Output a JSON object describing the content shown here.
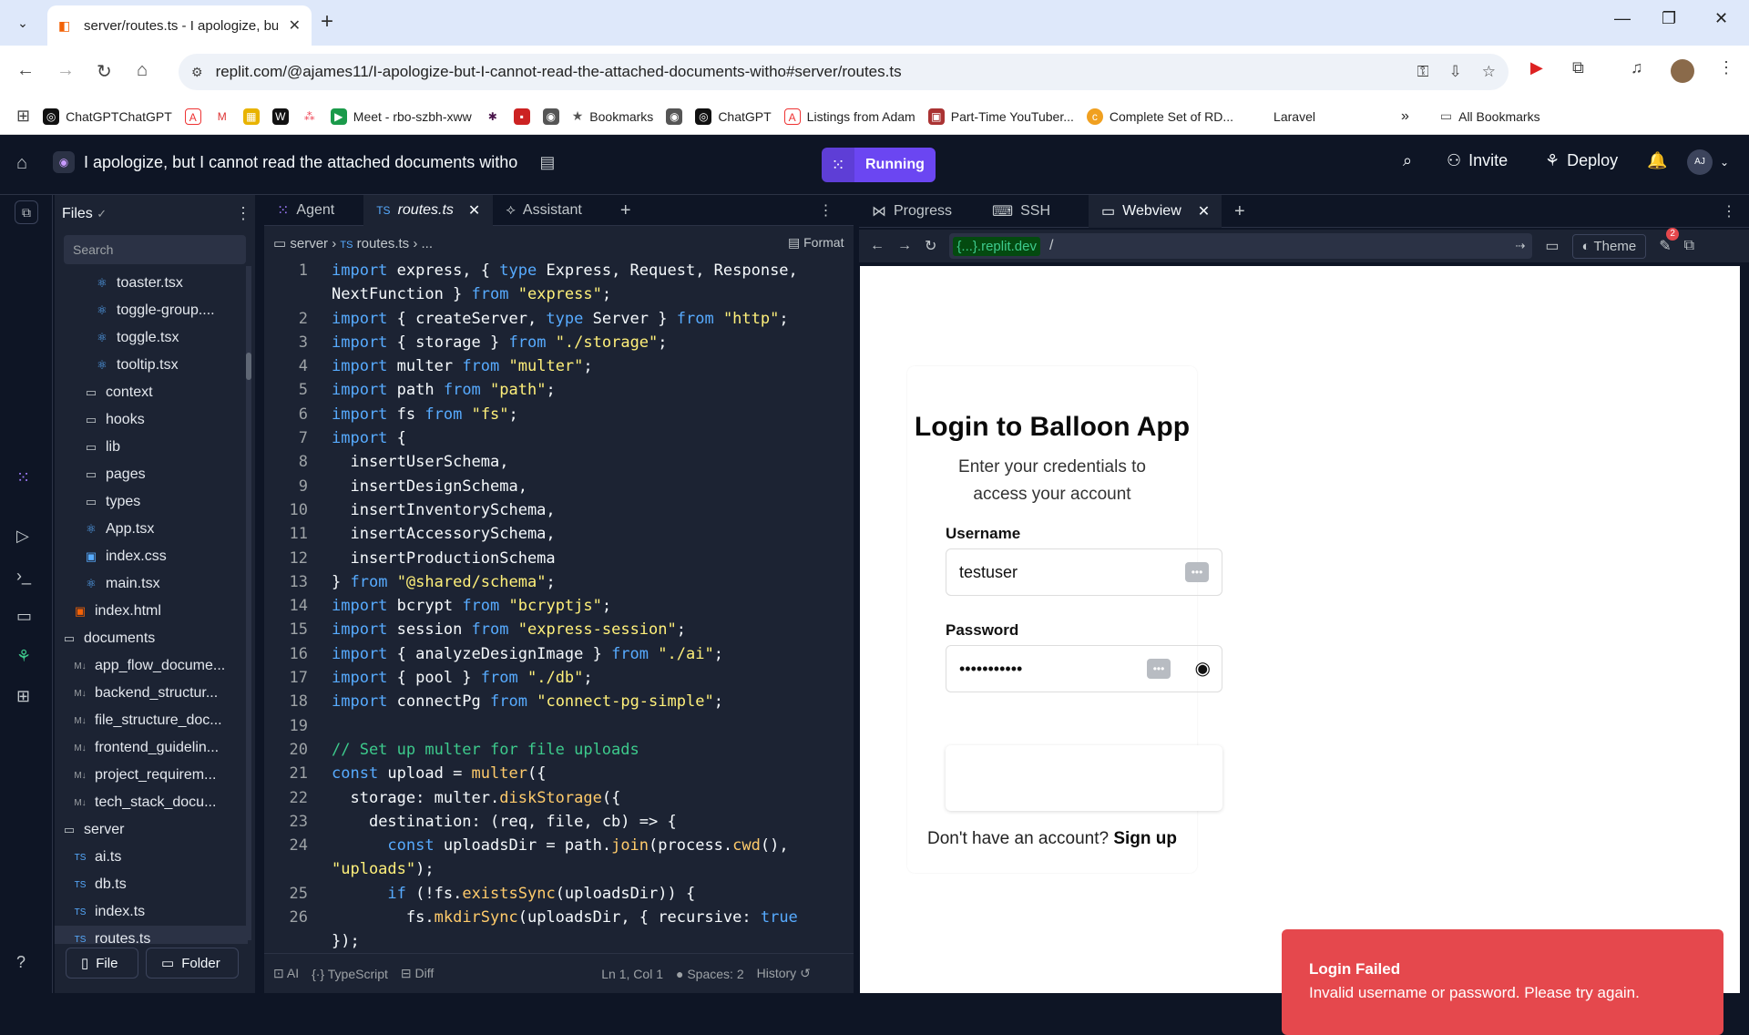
{
  "browser": {
    "tab_title": "server/routes.ts - I apologize, bu",
    "url": "replit.com/@ajames11/I-apologize-but-I-cannot-read-the-attached-documents-witho#server/routes.ts",
    "bookmarks": [
      "ChatGPTChatGPT",
      "Meet - rbo-szbh-xww",
      "Bookmarks",
      "ChatGPT",
      "Listings from Adam",
      "Part-Time YouTuber...",
      "Complete Set of RD...",
      "Laravel",
      "All Bookmarks"
    ]
  },
  "header": {
    "project_title": "I apologize, but I cannot read the attached documents witho",
    "run_label": "Running",
    "invite_label": "Invite",
    "deploy_label": "Deploy",
    "avatar_initials": "AJ"
  },
  "files": {
    "title": "Files",
    "search_placeholder": "Search",
    "items": [
      {
        "name": "toaster.tsx",
        "type": "react",
        "indent": 3
      },
      {
        "name": "toggle-group....",
        "type": "react",
        "indent": 3
      },
      {
        "name": "toggle.tsx",
        "type": "react",
        "indent": 3
      },
      {
        "name": "tooltip.tsx",
        "type": "react",
        "indent": 3
      },
      {
        "name": "context",
        "type": "folder",
        "indent": 2
      },
      {
        "name": "hooks",
        "type": "folder",
        "indent": 2
      },
      {
        "name": "lib",
        "type": "folder",
        "indent": 2
      },
      {
        "name": "pages",
        "type": "folder",
        "indent": 2
      },
      {
        "name": "types",
        "type": "folder",
        "indent": 2
      },
      {
        "name": "App.tsx",
        "type": "react",
        "indent": 2
      },
      {
        "name": "index.css",
        "type": "css",
        "indent": 2
      },
      {
        "name": "main.tsx",
        "type": "react",
        "indent": 2
      },
      {
        "name": "index.html",
        "type": "html",
        "indent": 1
      },
      {
        "name": "documents",
        "type": "folder",
        "indent": 0
      },
      {
        "name": "app_flow_docume...",
        "type": "md",
        "indent": 1
      },
      {
        "name": "backend_structur...",
        "type": "md",
        "indent": 1
      },
      {
        "name": "file_structure_doc...",
        "type": "md",
        "indent": 1
      },
      {
        "name": "frontend_guidelin...",
        "type": "md",
        "indent": 1
      },
      {
        "name": "project_requirem...",
        "type": "md",
        "indent": 1
      },
      {
        "name": "tech_stack_docu...",
        "type": "md",
        "indent": 1
      },
      {
        "name": "server",
        "type": "folder",
        "indent": 0
      },
      {
        "name": "ai.ts",
        "type": "ts",
        "indent": 1
      },
      {
        "name": "db.ts",
        "type": "ts",
        "indent": 1
      },
      {
        "name": "index.ts",
        "type": "ts",
        "indent": 1
      },
      {
        "name": "routes.ts",
        "type": "ts",
        "indent": 1,
        "selected": true
      }
    ],
    "file_btn": "File",
    "folder_btn": "Folder"
  },
  "editor": {
    "tabs": [
      "Agent",
      "routes.ts",
      "Assistant"
    ],
    "breadcrumb": [
      "server",
      "routes.ts",
      "..."
    ],
    "format_label": "Format",
    "lines": [
      {
        "n": "1",
        "html": "<span class='kw'>import</span> express, { <span class='kw'>type</span> Express, Request, Response,"
      },
      {
        "n": "",
        "html": "NextFunction } <span class='kw'>from</span> <span class='st'>\"express\"</span>;"
      },
      {
        "n": "2",
        "html": "<span class='kw'>import</span> { createServer, <span class='kw'>type</span> Server } <span class='kw'>from</span> <span class='st'>\"http\"</span>;"
      },
      {
        "n": "3",
        "html": "<span class='kw'>import</span> { storage } <span class='kw'>from</span> <span class='st'>\"./storage\"</span>;"
      },
      {
        "n": "4",
        "html": "<span class='kw'>import</span> multer <span class='kw'>from</span> <span class='st'>\"multer\"</span>;"
      },
      {
        "n": "5",
        "html": "<span class='kw'>import</span> path <span class='kw'>from</span> <span class='st'>\"path\"</span>;"
      },
      {
        "n": "6",
        "html": "<span class='kw'>import</span> fs <span class='kw'>from</span> <span class='st'>\"fs\"</span>;"
      },
      {
        "n": "7",
        "html": "<span class='kw'>import</span> {"
      },
      {
        "n": "8",
        "html": "  insertUserSchema,"
      },
      {
        "n": "9",
        "html": "  insertDesignSchema,"
      },
      {
        "n": "10",
        "html": "  insertInventorySchema,"
      },
      {
        "n": "11",
        "html": "  insertAccessorySchema,"
      },
      {
        "n": "12",
        "html": "  insertProductionSchema"
      },
      {
        "n": "13",
        "html": "} <span class='kw'>from</span> <span class='st'>\"@shared/schema\"</span>;"
      },
      {
        "n": "14",
        "html": "<span class='kw'>import</span> bcrypt <span class='kw'>from</span> <span class='st'>\"bcryptjs\"</span>;"
      },
      {
        "n": "15",
        "html": "<span class='kw'>import</span> session <span class='kw'>from</span> <span class='st'>\"express-session\"</span>;"
      },
      {
        "n": "16",
        "html": "<span class='kw'>import</span> { analyzeDesignImage } <span class='kw'>from</span> <span class='st'>\"./ai\"</span>;"
      },
      {
        "n": "17",
        "html": "<span class='kw'>import</span> { pool } <span class='kw'>from</span> <span class='st'>\"./db\"</span>;"
      },
      {
        "n": "18",
        "html": "<span class='kw'>import</span> connectPg <span class='kw'>from</span> <span class='st'>\"connect-pg-simple\"</span>;"
      },
      {
        "n": "19",
        "html": ""
      },
      {
        "n": "20",
        "html": "<span class='cm'>// Set up multer for file uploads</span>"
      },
      {
        "n": "21",
        "html": "<span class='kw'>const</span> upload = <span class='fn'>multer</span>({"
      },
      {
        "n": "22",
        "html": "  storage: multer.<span class='fn'>diskStorage</span>({"
      },
      {
        "n": "23",
        "html": "    destination: (req, file, cb) => {"
      },
      {
        "n": "24",
        "html": "      <span class='kw'>const</span> uploadsDir = path.<span class='fn'>join</span>(process.<span class='fn'>cwd</span>(),"
      },
      {
        "n": "",
        "html": "<span class='st'>\"uploads\"</span>);"
      },
      {
        "n": "25",
        "html": "      <span class='kw'>if</span> (!fs.<span class='fn'>existsSync</span>(uploadsDir)) {"
      },
      {
        "n": "26",
        "html": "        fs.<span class='fn'>mkdirSync</span>(uploadsDir, { recursive: <span class='kw'>true</span>"
      },
      {
        "n": "",
        "html": "});"
      }
    ],
    "status": {
      "ai": "AI",
      "lang": "TypeScript",
      "diff": "Diff",
      "pos": "Ln 1, Col 1",
      "spaces": "Spaces: 2",
      "history": "History"
    }
  },
  "webview": {
    "tabs": [
      "Progress",
      "SSH",
      "Webview"
    ],
    "domain": "{...}.replit.dev",
    "path": "/",
    "theme_label": "Theme",
    "badge_count": "2",
    "login": {
      "title": "Login to Balloon App",
      "subtitle": "Enter your credentials to access your account",
      "username_label": "Username",
      "username_value": "testuser",
      "password_label": "Password",
      "password_value": "•••••••••••",
      "signup_prompt": "Don't have an account?",
      "signup_link": "Sign up"
    },
    "toast": {
      "title": "Login Failed",
      "message": "Invalid username or password. Please try again."
    }
  }
}
